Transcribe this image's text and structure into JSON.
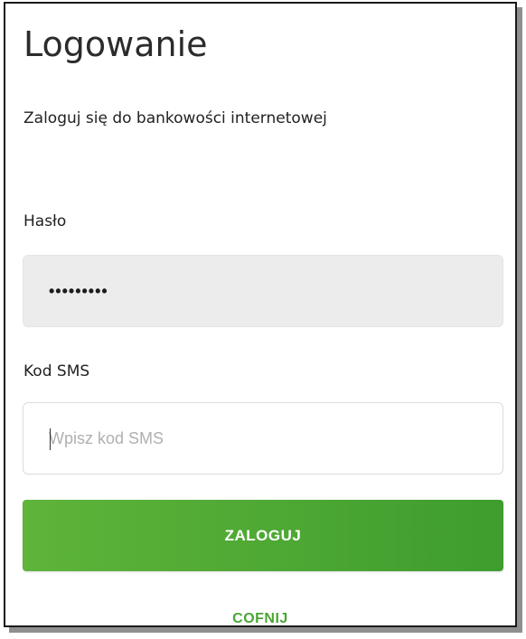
{
  "header": {
    "title": "Logowanie",
    "subtitle": "Zaloguj się do bankowości internetowej"
  },
  "form": {
    "password_label": "Hasło",
    "password_value": "•••••••••",
    "sms_label": "Kod SMS",
    "sms_placeholder": "Wpisz kod SMS",
    "sms_value": ""
  },
  "actions": {
    "login_label": "ZALOGUJ",
    "back_label": "COFNIJ"
  },
  "colors": {
    "accent_green": "#4aa534",
    "input_bg": "#ececec",
    "text": "#222222"
  }
}
